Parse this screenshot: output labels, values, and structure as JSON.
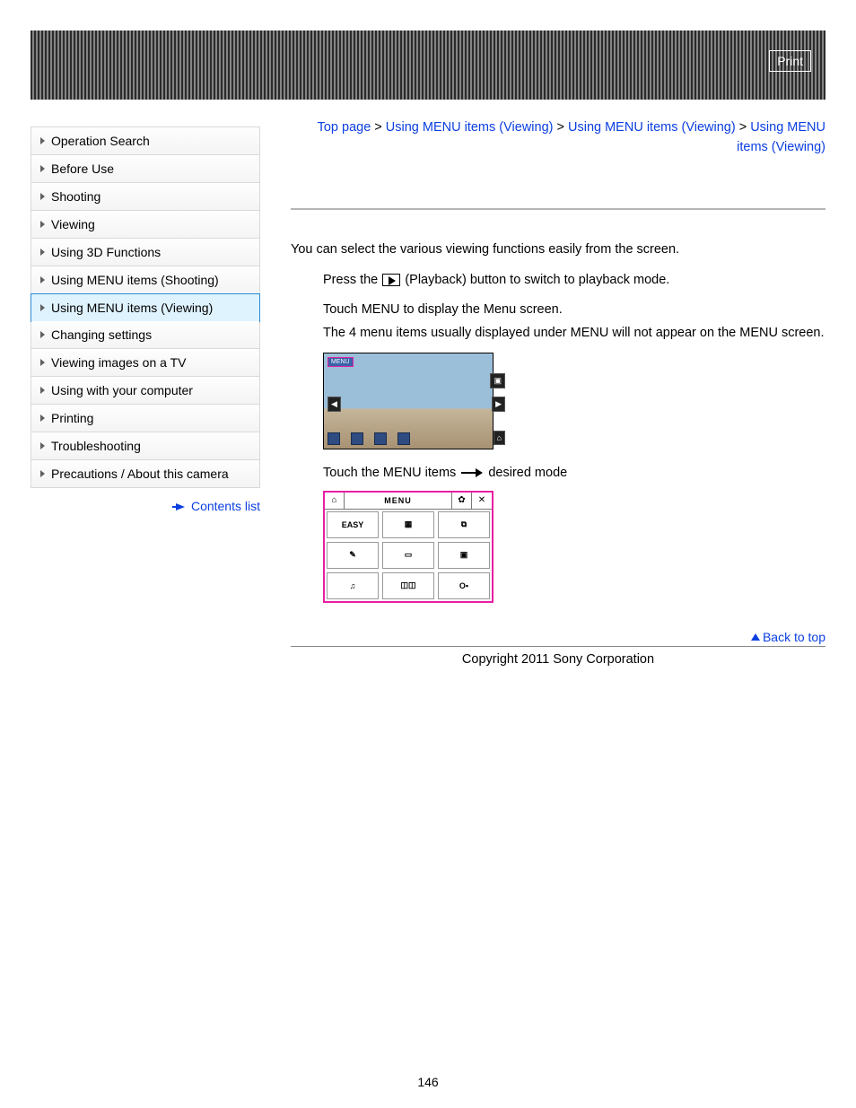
{
  "header": {
    "print_label": "Print"
  },
  "sidebar": {
    "items": [
      {
        "label": "Operation Search",
        "active": false
      },
      {
        "label": "Before Use",
        "active": false
      },
      {
        "label": "Shooting",
        "active": false
      },
      {
        "label": "Viewing",
        "active": false
      },
      {
        "label": "Using 3D Functions",
        "active": false
      },
      {
        "label": "Using MENU items (Shooting)",
        "active": false
      },
      {
        "label": "Using MENU items (Viewing)",
        "active": true
      },
      {
        "label": "Changing settings",
        "active": false
      },
      {
        "label": "Viewing images on a TV",
        "active": false
      },
      {
        "label": "Using with your computer",
        "active": false
      },
      {
        "label": "Printing",
        "active": false
      },
      {
        "label": "Troubleshooting",
        "active": false
      },
      {
        "label": "Precautions / About this camera",
        "active": false
      }
    ],
    "contents_list_label": "Contents list"
  },
  "breadcrumbs": {
    "parts": [
      "Top page",
      "Using MENU items (Viewing)",
      "Using MENU items (Viewing)",
      "Using MENU items (Viewing)"
    ],
    "sep": " > "
  },
  "main": {
    "intro": "You can select the various viewing functions easily from the screen.",
    "step1_pre": "Press the ",
    "playback_label": "(Playback)",
    "step1_post": " button to switch to playback mode.",
    "step2_a": "Touch MENU to display the Menu screen.",
    "step2_b": "The 4 menu items usually displayed under MENU will not appear on the MENU screen.",
    "step3_pre": "Touch the MENU items ",
    "step3_post": " desired mode",
    "cam_menu_tag": "MENU",
    "menu_head": {
      "title": "MENU",
      "home": "⌂",
      "gear": "✿",
      "close": "✕"
    },
    "menu_cells": [
      "EASY",
      "▦",
      "⧉",
      "✎",
      "▭",
      "▣",
      "♫",
      "◫◫",
      "O▪"
    ]
  },
  "footer": {
    "back_to_top": "Back to top",
    "copyright": "Copyright 2011 Sony Corporation",
    "page_number": "146"
  }
}
